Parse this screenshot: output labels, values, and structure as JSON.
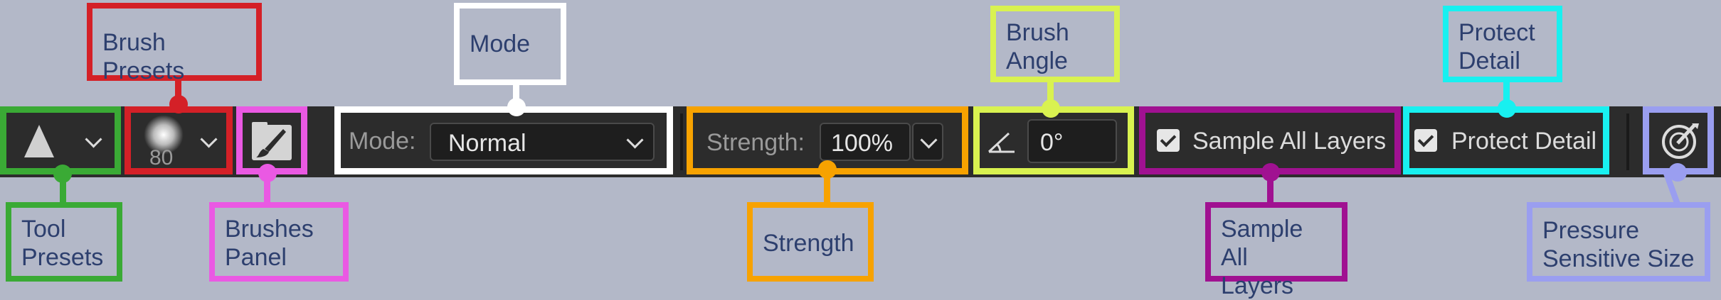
{
  "toolbar": {
    "brush_size": "80",
    "mode_label": "Mode:",
    "mode_value": "Normal",
    "strength_label": "Strength:",
    "strength_value": "100%",
    "angle_value": "0°",
    "sample_all_layers_label": "Sample All Layers",
    "sample_all_layers_checked": true,
    "protect_detail_label": "Protect Detail",
    "protect_detail_checked": true
  },
  "icons": {
    "tool_preset": "triangle-smudge-icon",
    "brush_preset": "soft-round-brush-icon",
    "brushes_panel": "brush-folder-icon",
    "angle": "angle-icon",
    "pressure": "pressure-size-icon"
  },
  "callouts": {
    "tool_presets": "Tool\nPresets",
    "brush_presets": "Brush Presets",
    "brushes_panel": "Brushes\nPanel",
    "mode": "Mode",
    "strength": "Strength",
    "brush_angle": "Brush\nAngle",
    "sample_all_layers": "Sample All\nLayers",
    "protect_detail": "Protect\nDetail",
    "pressure_sensitive_size": "Pressure\nSensitive Size"
  },
  "colors": {
    "background": "#b3b8c8",
    "toolbar": "#2c2c2c",
    "tool_presets": "#3aaa35",
    "brush_presets": "#d42027",
    "brushes_panel": "#ea59e3",
    "mode": "#ffffff",
    "strength": "#f7a200",
    "brush_angle": "#d9f250",
    "sample_all_layers": "#a01191",
    "protect_detail": "#18f0f0",
    "pressure_sensitive_size": "#9a9ef0",
    "label_text": "#2d3f6e"
  }
}
